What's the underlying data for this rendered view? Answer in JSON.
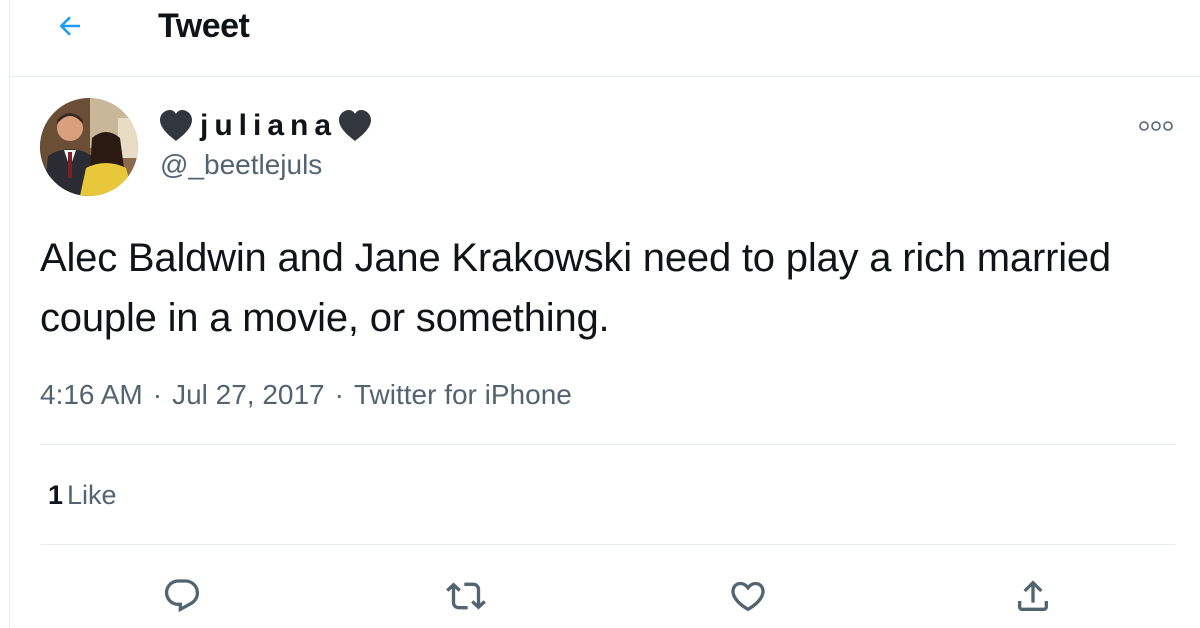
{
  "header": {
    "title": "Tweet",
    "back_icon": "arrow-left-icon"
  },
  "tweet": {
    "author": {
      "display_name": "juliana",
      "decor_icon": "black-heart-icon",
      "handle": "@_beetlejuls"
    },
    "text": "Alec Baldwin and Jane Krakowski need to play a rich married couple in a movie, or something.",
    "time": "4:16 AM",
    "date": "Jul 27, 2017",
    "separator": "·",
    "source": "Twitter for iPhone",
    "stats": {
      "likes_count": "1",
      "likes_label": "Like"
    },
    "actions": [
      {
        "name": "reply",
        "icon": "reply-icon"
      },
      {
        "name": "retweet",
        "icon": "retweet-icon"
      },
      {
        "name": "like",
        "icon": "heart-outline-icon"
      },
      {
        "name": "share",
        "icon": "share-icon"
      }
    ]
  },
  "colors": {
    "accent": "#1d9bf0",
    "text_primary": "#0f1419",
    "text_secondary": "#536471",
    "divider": "#e7ecf0"
  }
}
